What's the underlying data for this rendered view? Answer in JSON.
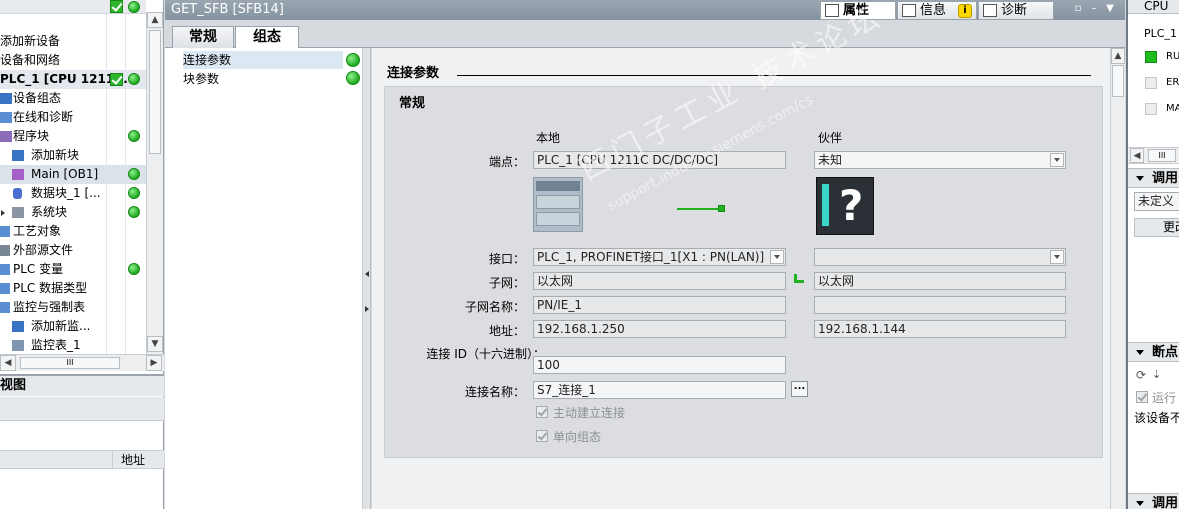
{
  "project_tree": {
    "items": [
      {
        "label": "添加新设备",
        "status": ""
      },
      {
        "label": "设备和网络",
        "status": ""
      },
      {
        "label": "PLC_1 [CPU 1211...",
        "status": "check"
      },
      {
        "label": "设备组态",
        "status": ""
      },
      {
        "label": "在线和诊断",
        "status": ""
      },
      {
        "label": "程序块",
        "status": "ok"
      },
      {
        "label": "添加新块",
        "status": ""
      },
      {
        "label": "Main [OB1]",
        "status": "ok"
      },
      {
        "label": "数据块_1 [...",
        "status": "ok"
      },
      {
        "label": "系统块",
        "status": "ok"
      },
      {
        "label": "工艺对象",
        "status": ""
      },
      {
        "label": "外部源文件",
        "status": ""
      },
      {
        "label": "PLC 变量",
        "status": "ok"
      },
      {
        "label": "PLC 数据类型",
        "status": ""
      },
      {
        "label": "监控与强制表",
        "status": ""
      },
      {
        "label": "添加新监...",
        "status": ""
      },
      {
        "label": "监控表_1",
        "status": ""
      }
    ],
    "hscroll_label": "III"
  },
  "details_view": {
    "title": "视图",
    "address_header": "地址"
  },
  "inspector": {
    "window_title": "GET_SFB [SFB14]",
    "right_tabs": {
      "properties": "属性",
      "info": "信息",
      "diagnostics": "诊断"
    },
    "tabs": [
      "常规",
      "组态"
    ],
    "nav": [
      "连接参数",
      "块参数"
    ],
    "section_title": "连接参数",
    "group_title": "常规",
    "col_local": "本地",
    "col_partner": "伙伴",
    "labels": {
      "endpoint": "端点：",
      "interface": "接口：",
      "subnet": "子网：",
      "subnet_name": "子网名称：",
      "address": "地址：",
      "conn_id": "连接 ID（十六进制）：",
      "conn_name": "连接名称："
    },
    "local": {
      "endpoint": "PLC_1 [CPU 1211C DC/DC/DC]",
      "interface": "PLC_1, PROFINET接口_1[X1 : PN(LAN)]",
      "subnet": "以太网",
      "subnet_name": "PN/IE_1",
      "address": "192.168.1.250"
    },
    "partner": {
      "endpoint": "未知",
      "interface": "",
      "subnet": "以太网",
      "subnet_name": "",
      "address": "192.168.1.144"
    },
    "conn_id": "100",
    "conn_name": "S7_连接_1",
    "browse_label": "...",
    "checkbox_active": "主动建立连接",
    "checkbox_oneway": "单向组态",
    "watermark": "西门子工业 技术论坛",
    "watermark_url": "support.industry.siemens.com/cs"
  },
  "task_panel": {
    "top_label": "CPU",
    "device": "PLC_1",
    "status_items": [
      "RU",
      "ER",
      "MA"
    ],
    "scroll_label": "III",
    "pane1": "调用",
    "undefined_text": "未定义",
    "change_button": "更改",
    "pane2": "断点",
    "run_checkbox": "运行",
    "device_note": "该设备不",
    "pane3": "调用"
  },
  "colors": {
    "status_ok": "#1faa1f",
    "title_bar": "#8f9ca8",
    "nav_selected": "#dbe7f3",
    "group_bg": "#dcdde0"
  }
}
